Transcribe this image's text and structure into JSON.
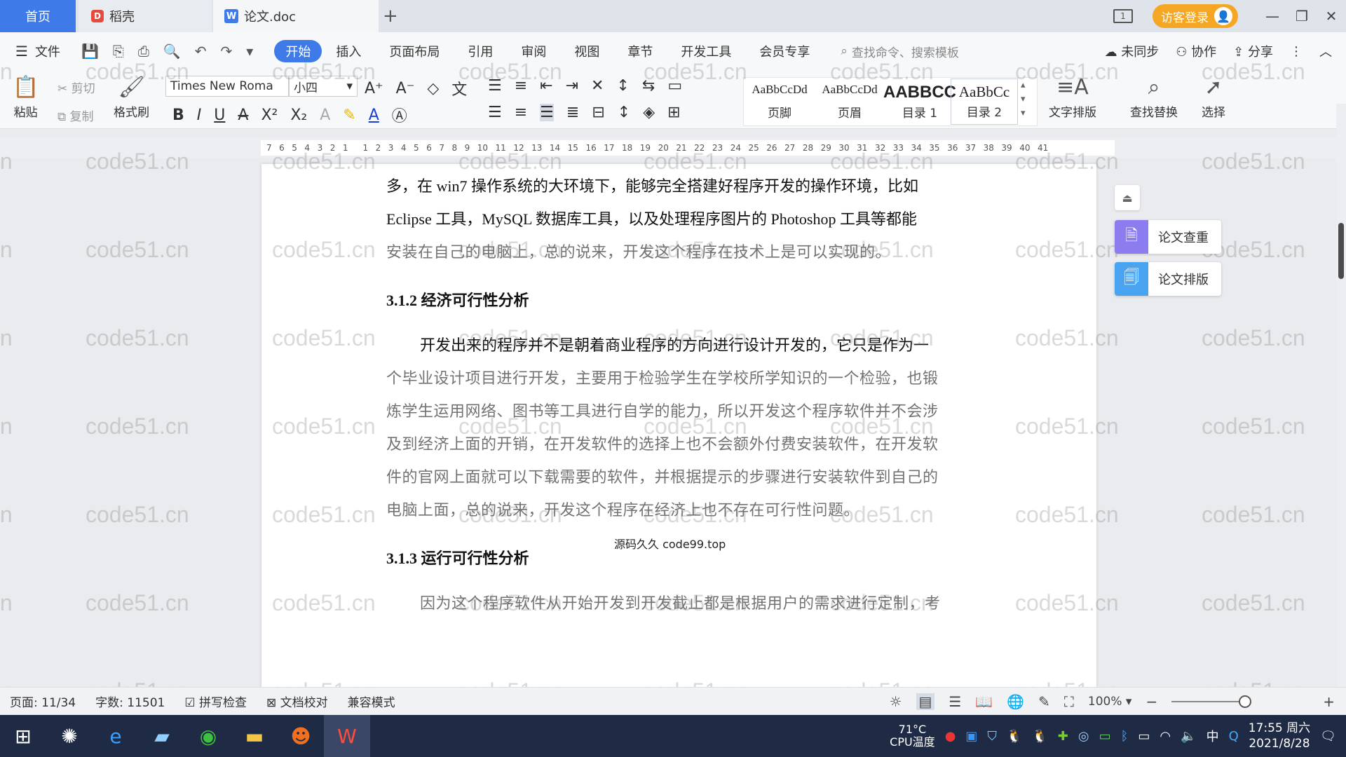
{
  "tabs": {
    "home": "首页",
    "daoke": "稻壳",
    "doc": "论文.doc"
  },
  "titlebar": {
    "guest_login": "访客登录"
  },
  "menu": {
    "file": "文件",
    "tabs": [
      "开始",
      "插入",
      "页面布局",
      "引用",
      "审阅",
      "视图",
      "章节",
      "开发工具",
      "会员专享"
    ],
    "search_placeholder": "查找命令、搜索模板",
    "right": [
      "未同步",
      "协作",
      "分享"
    ]
  },
  "ribbon": {
    "paste": "粘贴",
    "cut": "剪切",
    "copy": "复制",
    "format_painter": "格式刷",
    "font_name": "Times New Roma",
    "font_size": "小四",
    "styles": [
      {
        "sample": "AaBbCcDd",
        "name": "页脚"
      },
      {
        "sample": "AaBbCcDd",
        "name": "页眉"
      },
      {
        "sample": "AABBCC",
        "name": "目录 1"
      },
      {
        "sample": "AaBbCc",
        "name": "目录 2"
      }
    ],
    "text_layout": "文字排版",
    "find_replace": "查找替换",
    "select": "选择"
  },
  "ruler_ticks": [
    "7",
    "6",
    "5",
    "4",
    "3",
    "2",
    "1",
    "",
    "1",
    "2",
    "3",
    "4",
    "5",
    "6",
    "7",
    "8",
    "9",
    "10",
    "11",
    "12",
    "13",
    "14",
    "15",
    "16",
    "17",
    "18",
    "19",
    "20",
    "21",
    "22",
    "23",
    "24",
    "25",
    "26",
    "27",
    "28",
    "29",
    "30",
    "31",
    "32",
    "33",
    "34",
    "35",
    "36",
    "37",
    "38",
    "39",
    "40",
    "41"
  ],
  "document": {
    "para1_line1": "多，在 win7 操作系统的大环境下，能够完全搭建好程序开发的操作环境，比如",
    "para1_line2": "Eclipse 工具，MySQL 数据库工具，以及处理程序图片的 Photoshop 工具等都能",
    "para1_line3": "安装在自己的电脑上，总的说来，开发这个程序在技术上是可以实现的。",
    "heading_312": "3.1.2  经济可行性分析",
    "para2_line1": "开发出来的程序并不是朝着商业程序的方向进行设计开发的，它只是作为一",
    "para2_line2": "个毕业设计项目进行开发，主要用于检验学生在学校所学知识的一个检验，也锻",
    "para2_line3": "炼学生运用网络、图书等工具进行自学的能力，所以开发这个程序软件并不会涉",
    "para2_line4": "及到经济上面的开销，在开发软件的选择上也不会额外付费安装软件，在开发软",
    "para2_line5": "件的官网上面就可以下载需要的软件，并根据提示的步骤进行安装软件到自己的",
    "para2_line6": "电脑上面，总的说来，开发这个程序在经济上也不存在可行性问题。",
    "heading_313": "3.1.3  运行可行性分析",
    "para3_line1": "因为这个程序软件从开始开发到开发截止都是根据用户的需求进行定制，考",
    "overlay": "源码久久 code99.top"
  },
  "watermark": "code51.cn",
  "float_panel": {
    "check": "论文查重",
    "layout": "论文排版"
  },
  "statusbar": {
    "page": "页面: 11/34",
    "words": "字数: 11501",
    "spell": "拼写检查",
    "proof": "文档校对",
    "compat": "兼容模式",
    "zoom": "100%"
  },
  "taskbar": {
    "temp": "71°C",
    "cpu_label": "CPU温度",
    "ime": "中",
    "time": "17:55 周六",
    "date": "2021/8/28"
  },
  "colors": {
    "accent": "#3f7be8",
    "login": "#f5a623",
    "taskbar": "#1f2a44"
  }
}
